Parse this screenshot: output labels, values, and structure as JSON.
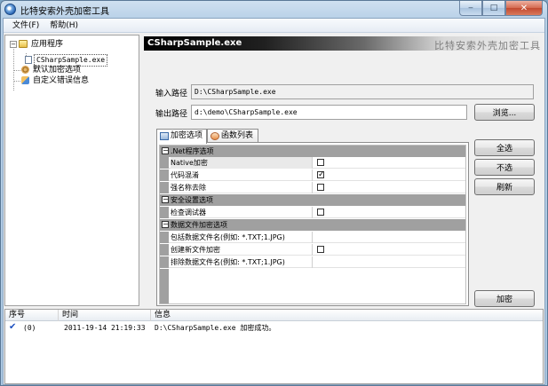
{
  "window": {
    "title": "比特安索外壳加密工具"
  },
  "menu": [
    {
      "label": "文件(F)"
    },
    {
      "label": "帮助(H)"
    }
  ],
  "tree": {
    "root": "应用程序",
    "child": "CSharpSample.exe",
    "item2": "默认加密选项",
    "item3": "自定义错误信息"
  },
  "header": {
    "title": "CSharpSample.exe",
    "brand": "比特安索外壳加密工具"
  },
  "form": {
    "input_label": "输入路径",
    "input_value": "D:\\CSharpSample.exe",
    "output_label": "输出路径",
    "output_value": "d:\\demo\\CSharpSample.exe",
    "browse": "浏览..."
  },
  "tabs": [
    {
      "label": "加密选项"
    },
    {
      "label": "函数列表"
    }
  ],
  "grid": {
    "cat1": ".Net程序选项",
    "p_native": "Native加密",
    "p_obf": "代码混淆",
    "p_strong": "强名称去除",
    "cat2": "安全设置选项",
    "p_debug": "检查调试器",
    "cat3": "数据文件加密选项",
    "p_include": "包括数据文件名(例如: *.TXT;1.JPG)",
    "p_create": "创建新文件加密",
    "p_exclude": "排除数据文件名(例如: *.TXT;1.JPG)"
  },
  "side_buttons": {
    "select_all": "全选",
    "select_none": "不选",
    "refresh": "刷新",
    "encrypt": "加密"
  },
  "log": {
    "columns": [
      {
        "label": "序号"
      },
      {
        "label": "时间"
      },
      {
        "label": "信息"
      }
    ],
    "rows": [
      {
        "index": "(0)",
        "time": "2011-19-14 21:19:33",
        "message": "D:\\CSharpSample.exe 加密成功。"
      }
    ]
  }
}
